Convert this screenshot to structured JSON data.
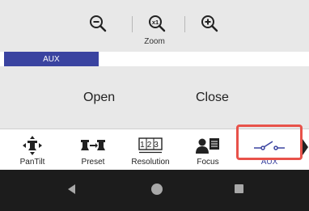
{
  "zoom": {
    "label": "Zoom",
    "buttons": [
      {
        "icon": "zoom-out-icon"
      },
      {
        "icon": "zoom-reset-icon",
        "glyph": "x1"
      },
      {
        "icon": "zoom-in-icon"
      }
    ]
  },
  "aux_status": {
    "label": "AUX",
    "level": 0.31,
    "fill_color": "#3a43a0"
  },
  "aux_controls": {
    "open_label": "Open",
    "close_label": "Close"
  },
  "tabs": [
    {
      "label": "PanTilt",
      "icon": "pantilt-icon"
    },
    {
      "label": "Preset",
      "icon": "preset-icon"
    },
    {
      "label": "Resolution",
      "icon": "resolution-icon",
      "glyph": "123"
    },
    {
      "label": "Focus",
      "icon": "focus-icon"
    },
    {
      "label": "AUX",
      "icon": "aux-switch-icon",
      "selected": true
    }
  ],
  "colors": {
    "accent": "#3a43a0",
    "highlight": "#e8524a"
  },
  "nav": {
    "icons": [
      "back-icon",
      "home-icon",
      "recent-apps-icon"
    ]
  }
}
